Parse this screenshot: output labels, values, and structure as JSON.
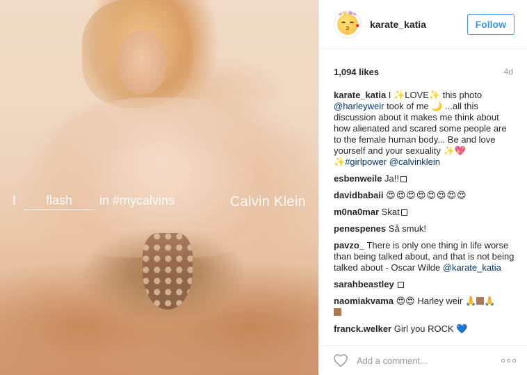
{
  "post": {
    "image": {
      "overlay_prefix": "I",
      "overlay_blank_word": "flash",
      "overlay_hashtag": "in #mycalvins",
      "overlay_brand": "Calvin Klein"
    },
    "header": {
      "username": "karate_katia",
      "follow_label": "Follow",
      "avatar_icon": "kissing-face-flower-crown-icon"
    },
    "stats": {
      "likes": "1,094 likes",
      "time": "4d"
    },
    "caption": {
      "user": "karate_katia",
      "t1": "I ",
      "spark1": "✨",
      "t2": "LOVE",
      "spark2": "✨",
      "t3": " this photo",
      "mention1": "@harleyweir",
      "t4": " took of me ",
      "moon": "🌙",
      "t5": " ...all this discussion about it makes me think about how alienated and scared some people are to the female human body... Be and love yourself and your sexuality ",
      "spark3": "✨",
      "heart": "💖",
      "spark4": "✨",
      "hashtag": "#girlpower",
      "mention2": "@calvinklein"
    },
    "comments": [
      {
        "user": "esbenweile",
        "text": "Ja!!"
      },
      {
        "user": "davidbabaii",
        "text": "😍😍😍😍😍😍😍😍"
      },
      {
        "user": "m0na0mar",
        "text": "Skat"
      },
      {
        "user": "penespenes",
        "text": "Så smuk!"
      },
      {
        "user": "pavzo_",
        "text": "There is only one thing in life worse than being talked about, and that is not being talked about - Oscar Wilde",
        "mention": "@karate_katia"
      },
      {
        "user": "sarahbeastley",
        "text": ""
      },
      {
        "user": "naomiakvama",
        "text_a": "😍😍",
        "text_b": " Harley weir ",
        "pray": "🙏"
      },
      {
        "user": "franck.welker",
        "text": "Girl you ROCK",
        "heart": "💙"
      }
    ],
    "footer": {
      "heart_icon": "heart-outline-icon",
      "placeholder": "Add a comment...",
      "more_icon": "more-options-icon"
    }
  }
}
